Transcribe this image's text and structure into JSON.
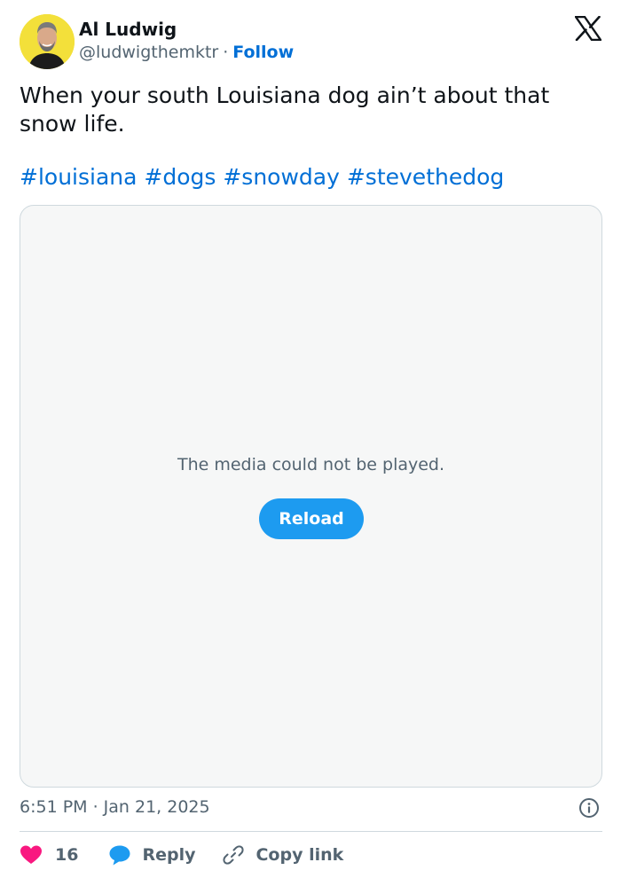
{
  "author": {
    "name": "Al Ludwig",
    "handle": "@ludwigthemktr",
    "separator": "·",
    "follow_label": "Follow",
    "avatar_color": "#f3e03a"
  },
  "tweet": {
    "text": "When your south Louisiana dog ain’t about that snow life.",
    "hashtags": [
      "#louisiana",
      "#dogs",
      "#snowday",
      "#stevethedog"
    ]
  },
  "media": {
    "message": "The media could not be played.",
    "reload_label": "Reload"
  },
  "meta": {
    "timestamp": "6:51 PM · Jan 21, 2025"
  },
  "actions": {
    "like_count": "16",
    "reply_label": "Reply",
    "copy_label": "Copy link"
  },
  "colors": {
    "link": "#006fd6",
    "button": "#1d9bf0",
    "like": "#f91880",
    "muted": "#536471"
  },
  "icons": {
    "brand": "x-logo-icon",
    "info": "info-icon",
    "like": "heart-icon",
    "reply": "speech-bubble-icon",
    "copy": "link-icon"
  }
}
